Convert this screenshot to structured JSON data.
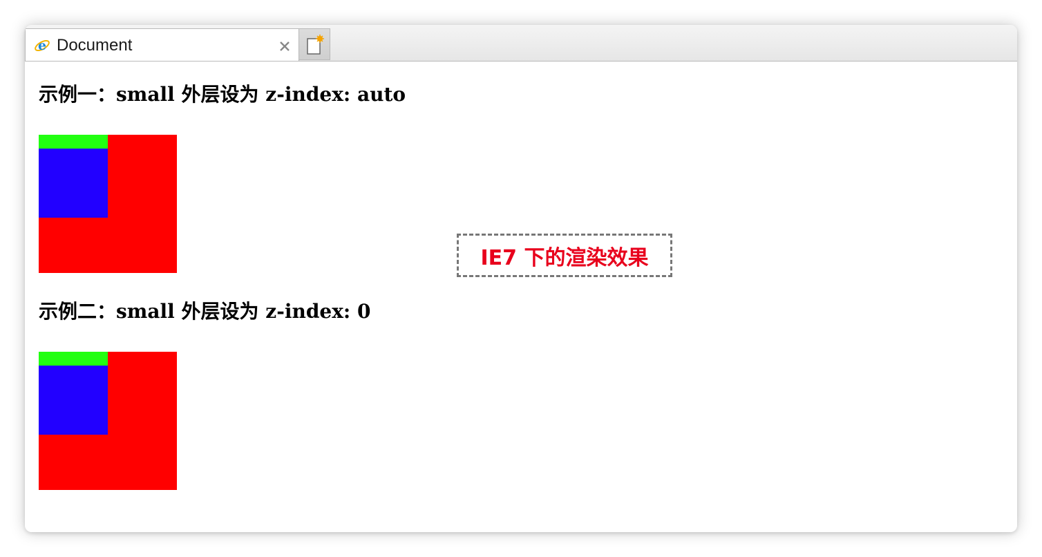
{
  "tab": {
    "title": "Document",
    "icon": "internet-explorer-icon",
    "close_icon": "close-icon",
    "new_tab_icon": "new-tab-icon"
  },
  "examples": [
    {
      "heading": "示例一：small 外层设为  z-index: auto",
      "colors": {
        "outer": "#ff0000",
        "bar": "#22ff11",
        "inner": "#2200ff"
      }
    },
    {
      "heading": "示例二：small 外层设为  z-index: 0",
      "colors": {
        "outer": "#ff0000",
        "bar": "#22ff11",
        "inner": "#2200ff"
      }
    }
  ],
  "annotation": {
    "text": "IE7 下的渲染效果",
    "color": "#e8001c"
  }
}
